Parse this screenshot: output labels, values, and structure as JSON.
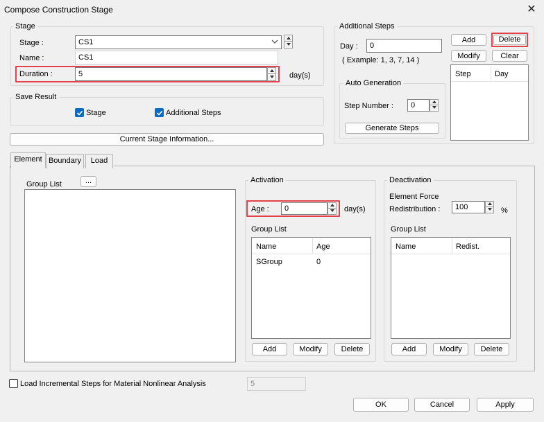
{
  "window": {
    "title": "Compose Construction Stage"
  },
  "stage_group": {
    "label": "Stage",
    "stage_label": "Stage :",
    "stage_value": "CS1",
    "name_label": "Name :",
    "name_value": "CS1",
    "duration_label": "Duration :",
    "duration_value": "5",
    "duration_unit": "day(s)"
  },
  "save_result": {
    "label": "Save Result",
    "stage_check_label": "Stage",
    "stage_checked": true,
    "additional_check_label": "Additional Steps",
    "additional_checked": true
  },
  "current_stage_info_button": "Current Stage Information...",
  "additional_steps": {
    "label": "Additional Steps",
    "day_label": "Day :",
    "day_value": "0",
    "example": "( Example: 1, 3, 7, 14  )",
    "add": "Add",
    "delete": "Delete",
    "modify": "Modify",
    "clear": "Clear",
    "columns": [
      "Step",
      "Day"
    ],
    "auto_generation": {
      "label": "Auto Generation",
      "step_number_label": "Step Number  :",
      "step_number_value": "0",
      "generate_button": "Generate Steps"
    }
  },
  "tabs": [
    "Element",
    "Boundary",
    "Load"
  ],
  "element_tab": {
    "group_list_label": "Group List",
    "browse_button": "...",
    "activation": {
      "label": "Activation",
      "age_label": "Age  :",
      "age_value": "0",
      "age_unit": "day(s)",
      "group_list_label": "Group List",
      "columns": [
        "Name",
        "Age"
      ],
      "rows": [
        {
          "name": "SGroup",
          "age": "0"
        }
      ],
      "add": "Add",
      "modify": "Modify",
      "delete": "Delete"
    },
    "deactivation": {
      "label": "Deactivation",
      "force_label_1": "Element Force",
      "force_label_2": "Redistribution :",
      "redistribution_value": "100",
      "percent": "%",
      "group_list_label": "Group List",
      "columns": [
        "Name",
        "Redist."
      ],
      "add": "Add",
      "modify": "Modify",
      "delete": "Delete"
    }
  },
  "load_incremental": {
    "label": "Load Incremental Steps for Material Nonlinear Analysis",
    "checked": false,
    "value": "5"
  },
  "footer": {
    "ok": "OK",
    "cancel": "Cancel",
    "apply": "Apply"
  },
  "colors": {
    "highlight": "#e5414d",
    "checkbox": "#0f6cbd"
  }
}
